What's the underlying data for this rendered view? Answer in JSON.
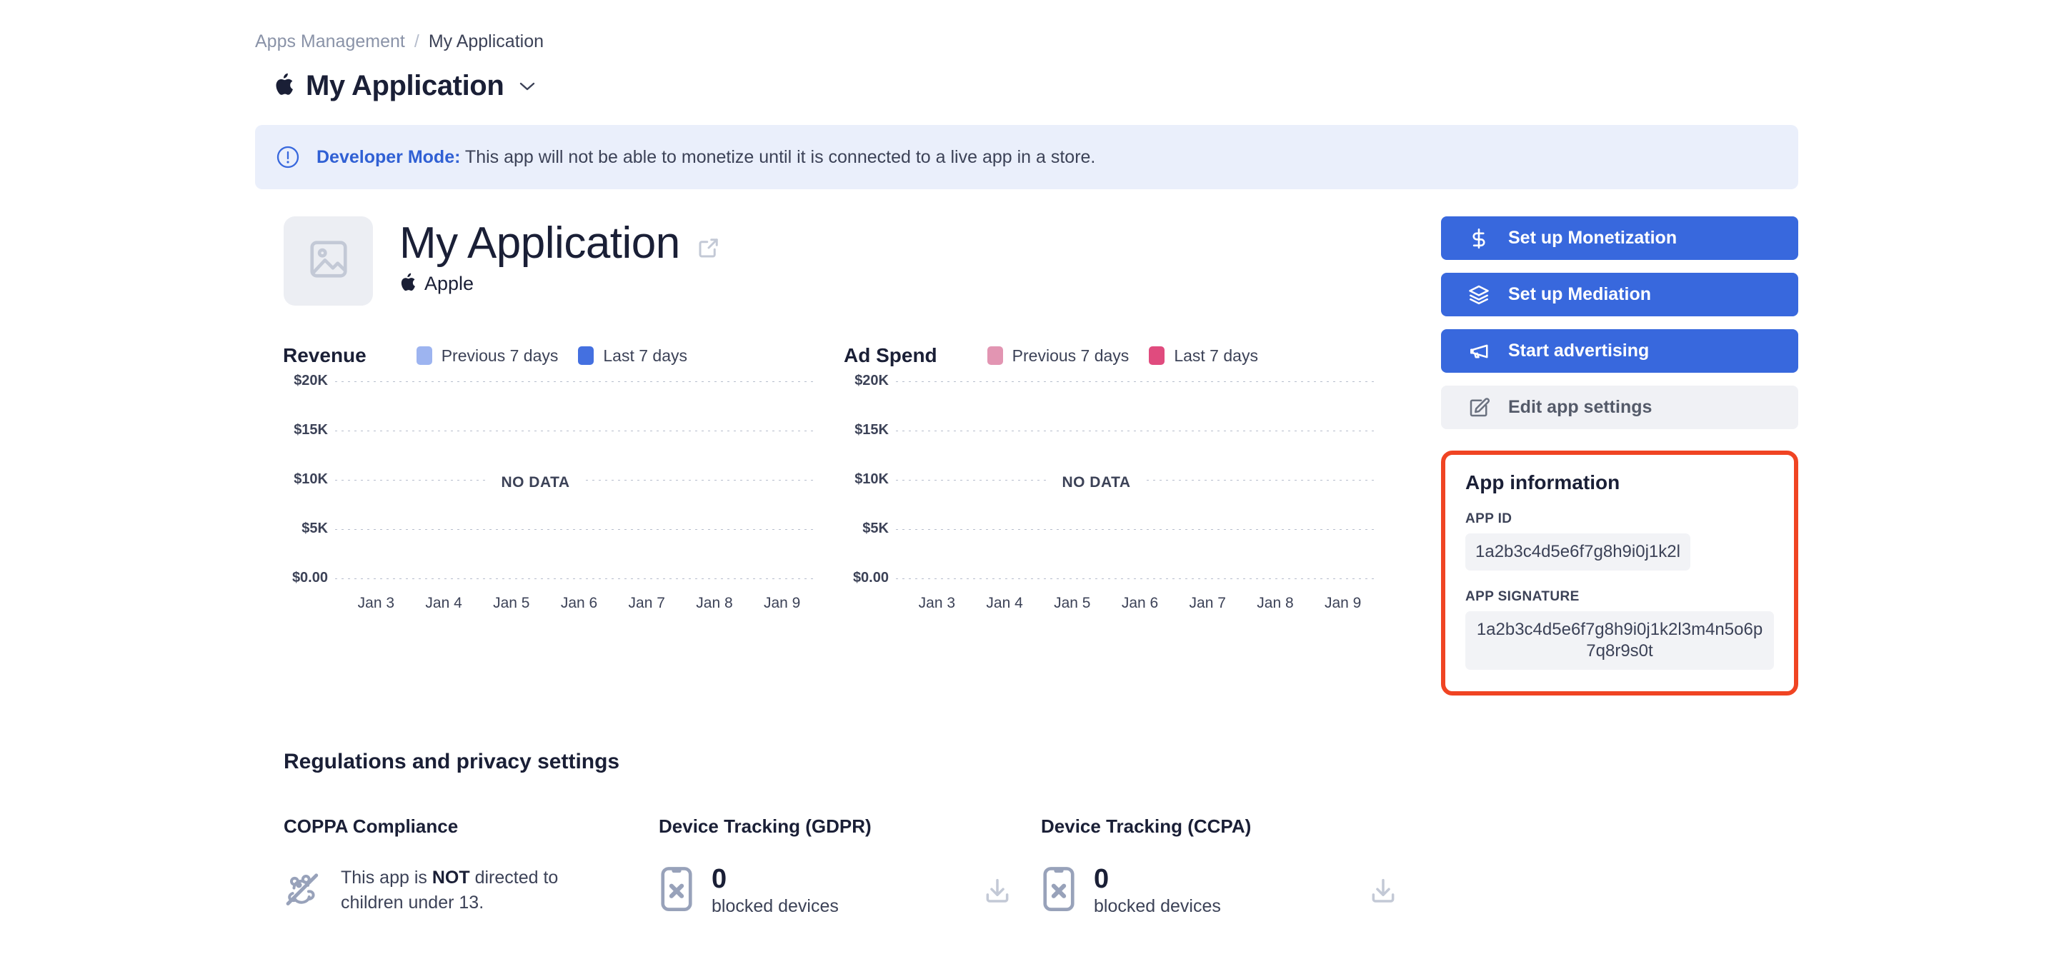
{
  "breadcrumb": {
    "parent": "Apps Management",
    "separator": "/",
    "current": "My Application"
  },
  "app_switcher": {
    "title": "My Application",
    "platform_icon": "apple-icon",
    "chevron_icon": "chevron-down-icon"
  },
  "banner": {
    "icon": "info-circle-icon",
    "strong": "Developer Mode:",
    "message": " This app will not be able to monetize until it is connected to a live app in a store.",
    "background": "#eaeffb",
    "accent": "#3060d4"
  },
  "app_header": {
    "thumbnail_icon": "image-placeholder-icon",
    "title": "My Application",
    "external_link_icon": "external-link-icon",
    "platform_icon": "apple-icon",
    "platform": "Apple"
  },
  "actions": [
    {
      "label": "Set up Monetization",
      "icon": "dollar-icon",
      "style": "primary"
    },
    {
      "label": "Set up Mediation",
      "icon": "layers-icon",
      "style": "primary"
    },
    {
      "label": "Start advertising",
      "icon": "megaphone-icon",
      "style": "primary"
    },
    {
      "label": "Edit app settings",
      "icon": "edit-square-icon",
      "style": "secondary"
    }
  ],
  "app_information": {
    "title": "App information",
    "app_id_label": "APP ID",
    "app_id_value": "1a2b3c4d5e6f7g8h9i0j1k2l",
    "app_signature_label": "APP SIGNATURE",
    "app_signature_value": "1a2b3c4d5e6f7g8h9i0j1k2l3m4n5o6p7q8r9s0t",
    "highlight_color": "#f04423"
  },
  "chart_data": [
    {
      "type": "line",
      "title": "Revenue",
      "xlabel": "",
      "ylabel": "",
      "categories": [
        "Jan 3",
        "Jan 4",
        "Jan 5",
        "Jan 6",
        "Jan 7",
        "Jan 8",
        "Jan 9"
      ],
      "yticks": [
        "$20K",
        "$15K",
        "$10K",
        "$5K",
        "$0.00"
      ],
      "ylim": [
        0,
        20000
      ],
      "grid": true,
      "legend_position": "top-right",
      "empty_state": "NO DATA",
      "series": [
        {
          "name": "Previous 7 days",
          "color": "#9db4f0",
          "values": []
        },
        {
          "name": "Last 7 days",
          "color": "#4470e0",
          "values": []
        }
      ]
    },
    {
      "type": "line",
      "title": "Ad Spend",
      "xlabel": "",
      "ylabel": "",
      "categories": [
        "Jan 3",
        "Jan 4",
        "Jan 5",
        "Jan 6",
        "Jan 7",
        "Jan 8",
        "Jan 9"
      ],
      "yticks": [
        "$20K",
        "$15K",
        "$10K",
        "$5K",
        "$0.00"
      ],
      "ylim": [
        0,
        20000
      ],
      "grid": true,
      "legend_position": "top-right",
      "empty_state": "NO DATA",
      "series": [
        {
          "name": "Previous 7 days",
          "color": "#e295b2",
          "values": []
        },
        {
          "name": "Last 7 days",
          "color": "#e04b7e",
          "values": []
        }
      ]
    }
  ],
  "regulations": {
    "title": "Regulations and privacy settings",
    "coppa": {
      "heading": "COPPA Compliance",
      "icon": "teddy-bear-slash-icon",
      "text_before": "This app is ",
      "text_strong": "NOT",
      "text_after": " directed to children under 13."
    },
    "gdpr": {
      "heading": "Device Tracking (GDPR)",
      "icon": "phone-blocked-icon",
      "count": "0",
      "count_label": "blocked devices",
      "download_icon": "download-icon"
    },
    "ccpa": {
      "heading": "Device Tracking (CCPA)",
      "icon": "phone-blocked-icon",
      "count": "0",
      "count_label": "blocked devices",
      "download_icon": "download-icon"
    }
  }
}
